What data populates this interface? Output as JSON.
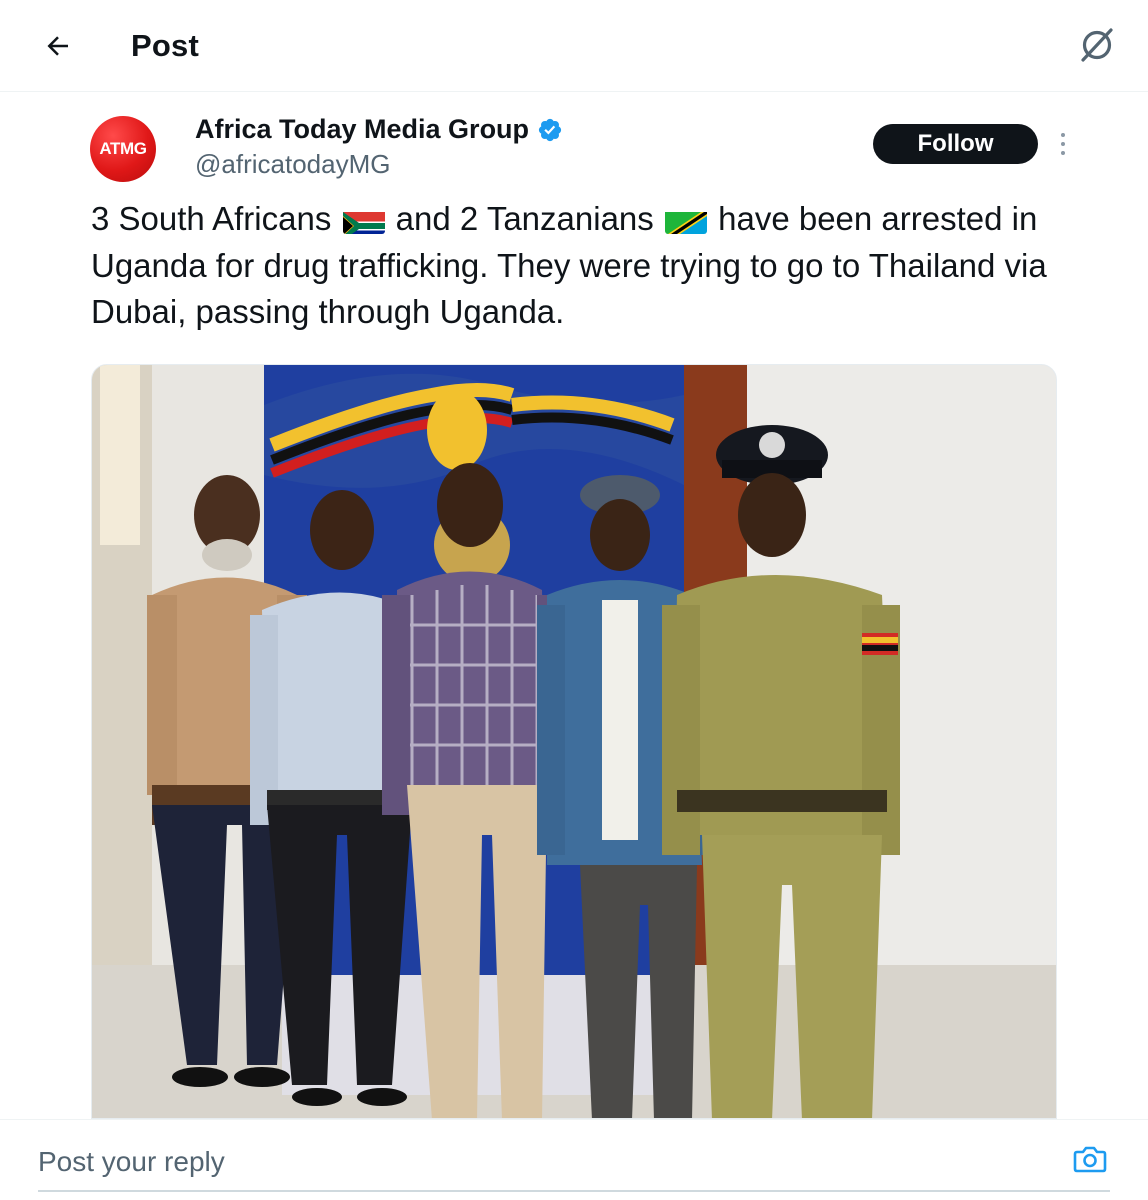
{
  "header": {
    "title": "Post",
    "back_icon": "arrow-left-icon",
    "grok_icon": "grok-icon"
  },
  "author": {
    "avatar_text": "ATMG",
    "name": "Africa Today Media Group",
    "handle": "@africatodayMG",
    "verified": true,
    "follow_label": "Follow"
  },
  "post": {
    "text_part1": "3 South Africans",
    "flag1": "south-africa-flag",
    "text_part2": " and 2 Tanzanians",
    "flag2": "tanzania-flag",
    "text_part3": " have been arrested in Uganda for drug trafficking. They were trying to go to Thailand via Dubai, passing through Uganda."
  },
  "reply": {
    "placeholder": "Post your reply",
    "camera_icon": "camera-icon"
  },
  "colors": {
    "accent": "#1d9bf0",
    "text": "#0f1419",
    "secondary": "#536471",
    "brand_red": "#e01818"
  }
}
